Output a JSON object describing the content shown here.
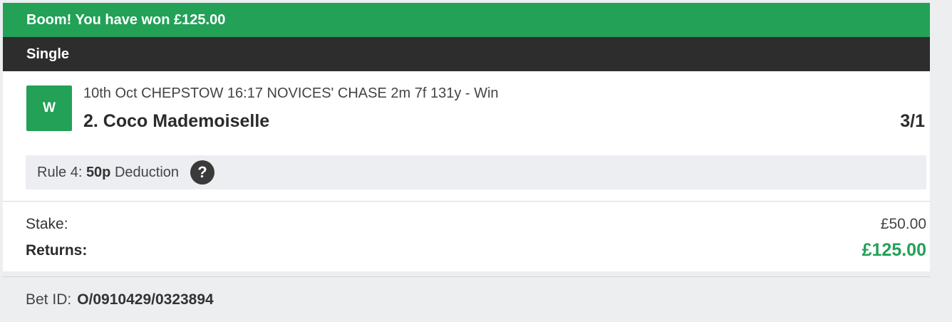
{
  "banner": {
    "text": "Boom! You have won £125.00"
  },
  "bet_type": "Single",
  "selection": {
    "result_badge": "W",
    "event": "10th Oct CHEPSTOW 16:17 NOVICES' CHASE 2m 7f 131y - Win",
    "runner": "2. Coco Mademoiselle",
    "odds": "3/1"
  },
  "rule4": {
    "prefix": "Rule 4:",
    "amount": "50p",
    "suffix": "Deduction",
    "help_icon": "question-icon",
    "help_glyph": "?"
  },
  "totals": {
    "stake_label": "Stake:",
    "stake_value": "£50.00",
    "returns_label": "Returns:",
    "returns_value": "£125.00"
  },
  "bet_id": {
    "label": "Bet ID:",
    "value": "O/0910429/0323894"
  },
  "colors": {
    "win_green": "#22a157",
    "header_dark": "#2d2d2d"
  }
}
